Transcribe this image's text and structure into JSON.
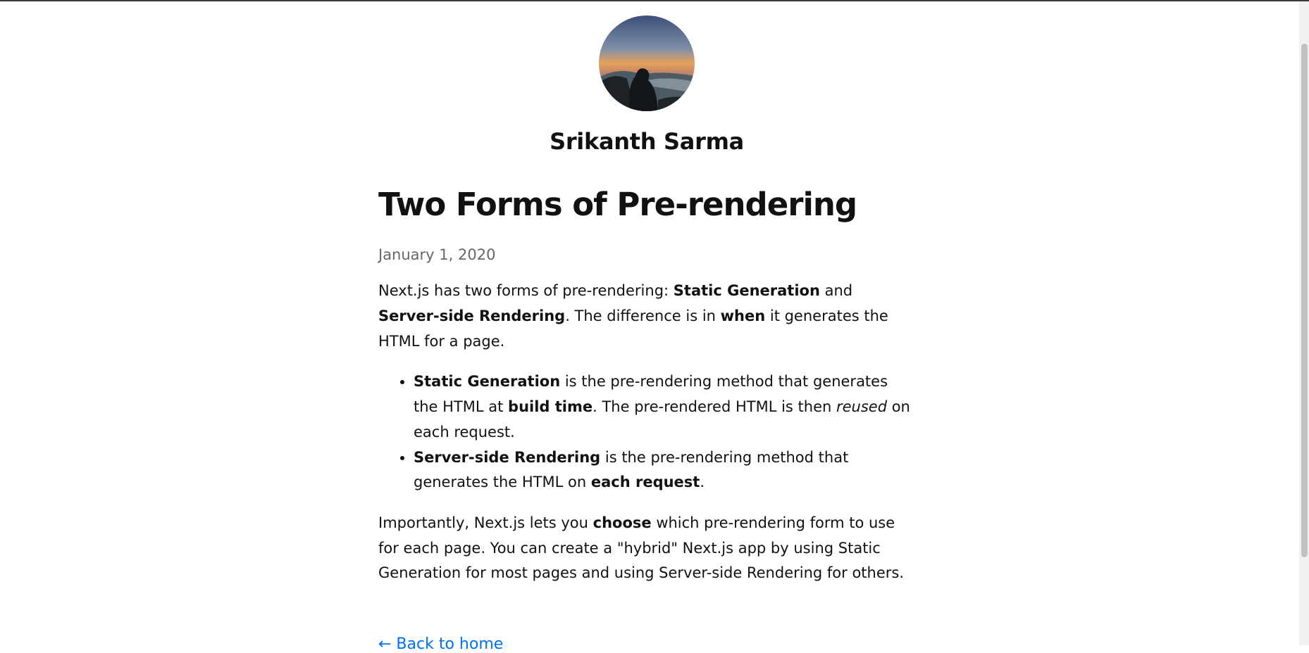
{
  "site": {
    "author_name": "Srikanth Sarma",
    "avatar_icon": "profile-photo-landscape"
  },
  "post": {
    "title": "Two Forms of Pre-rendering",
    "date": "January 1, 2020",
    "intro": {
      "t1": "Next.js has two forms of pre-rendering: ",
      "b1": "Static Generation",
      "t2": " and ",
      "b2": "Server-side Rendering",
      "t3": ". The difference is in ",
      "b3": "when",
      "t4": " it generates the HTML for a page."
    },
    "bullets": [
      {
        "b1": "Static Generation",
        "t1": " is the pre-rendering method that generates the HTML at ",
        "b2": "build time",
        "t2": ". The pre-rendered HTML is then ",
        "i1": "reused",
        "t3": " on each request."
      },
      {
        "b1": "Server-side Rendering",
        "t1": " is the pre-rendering method that generates the HTML on ",
        "b2": "each request",
        "t2": "."
      }
    ],
    "closing": {
      "t1": "Importantly, Next.js lets you ",
      "b1": "choose",
      "t2": " which pre-rendering form to use for each page. You can create a \"hybrid\" Next.js app by using Static Generation for most pages and using Server-side Rendering for others."
    }
  },
  "nav": {
    "back_label": "← Back to home"
  },
  "colors": {
    "link": "#0070f3",
    "date": "#666666",
    "text": "#111111"
  }
}
